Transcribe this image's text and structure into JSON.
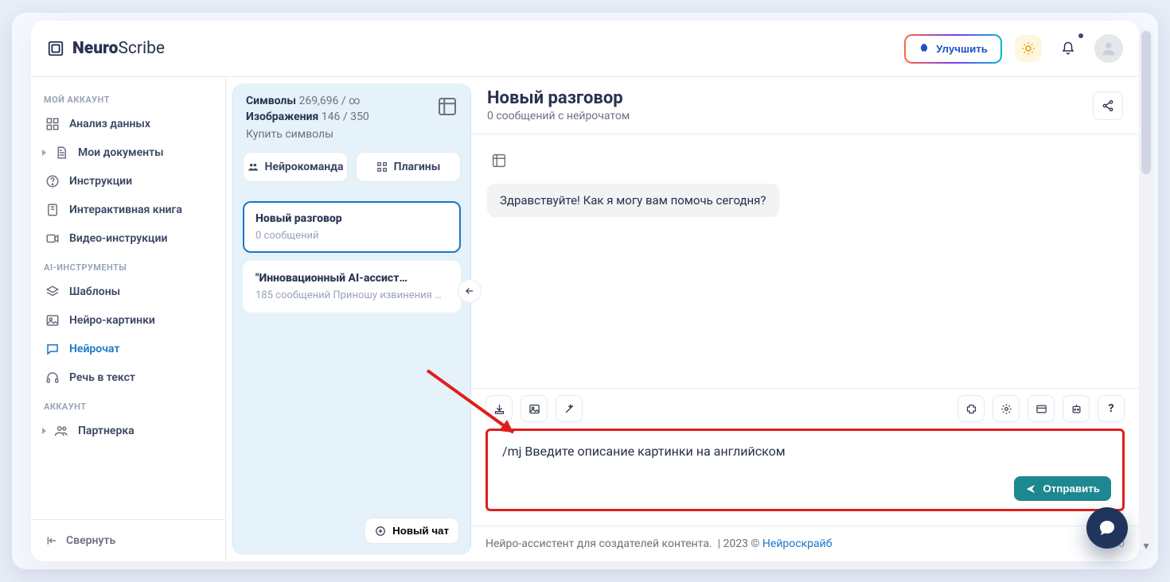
{
  "brand": {
    "name_bold": "Neuro",
    "name_rest": "Scribe"
  },
  "header": {
    "upgrade_label": "Улучшить"
  },
  "sidebar": {
    "group_account": "МОЙ АККАУНТ",
    "group_ai": "AI-ИНСТРУМЕНТЫ",
    "group_acct": "АККАУНТ",
    "items_account": [
      {
        "label": "Анализ данных",
        "icon": "grid"
      },
      {
        "label": "Мои документы",
        "icon": "doc",
        "caret": true
      },
      {
        "label": "Инструкции",
        "icon": "help"
      },
      {
        "label": "Интерактивная книга",
        "icon": "book"
      },
      {
        "label": "Видео-инструкции",
        "icon": "video"
      }
    ],
    "items_ai": [
      {
        "label": "Шаблоны",
        "icon": "layers"
      },
      {
        "label": "Нейро-картинки",
        "icon": "image"
      },
      {
        "label": "Нейрочат",
        "icon": "chat",
        "active": true
      },
      {
        "label": "Речь в текст",
        "icon": "headphones"
      }
    ],
    "items_acct": [
      {
        "label": "Партнерка",
        "icon": "users",
        "caret": true
      }
    ],
    "collapse_label": "Свернуть"
  },
  "stats": {
    "symbols_label": "Символы",
    "symbols_value": "269,696 / ∞",
    "images_label": "Изображения",
    "images_value": "146 / 350",
    "buy_label": "Купить символы"
  },
  "pills": {
    "team": "Нейрокоманда",
    "plugins": "Плагины"
  },
  "conversations": [
    {
      "title": "Новый разговор",
      "subtitle": "0 сообщений",
      "active": true
    },
    {
      "title": "\"Инновационный AI-ассист…",
      "subtitle": "185 сообщений Приношу извинения …",
      "active": false
    }
  ],
  "new_chat": "Новый чат",
  "chat": {
    "title": "Новый разговор",
    "subtitle": "0 сообщений с нейрочатом",
    "greeting": "Здравствуйте! Как я могу вам помочь сегодня?"
  },
  "composer": {
    "value": "/mj Введите описание картинки на английском",
    "send": "Отправить"
  },
  "footer": {
    "tagline": "Нейро-ассистент для создателей контента.",
    "year": "2023 ©",
    "brand_link": "Нейроскрайб",
    "version": "v2.0"
  }
}
